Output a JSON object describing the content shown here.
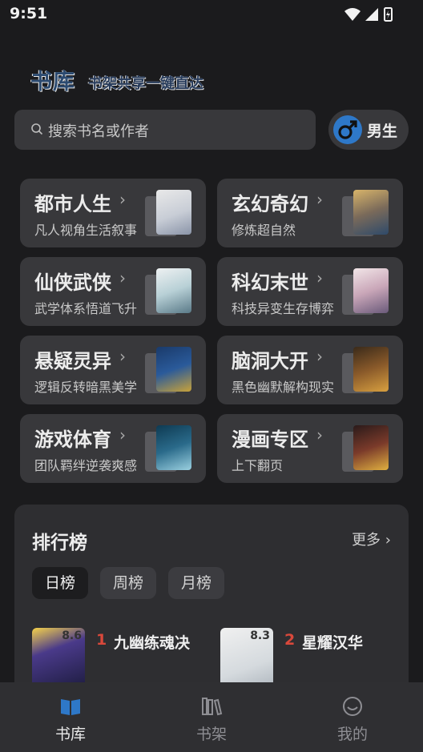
{
  "status_bar": {
    "time": "9:51"
  },
  "header": {
    "title": "书库",
    "slogan": "书架共享一键直达"
  },
  "search": {
    "placeholder": "搜索书名或作者"
  },
  "gender_toggle": {
    "label": "男生"
  },
  "categories": [
    {
      "name": "都市人生",
      "desc": "凡人视角生活叙事"
    },
    {
      "name": "玄幻奇幻",
      "desc": "修炼超自然"
    },
    {
      "name": "仙侠武侠",
      "desc": "武学体系悟道飞升"
    },
    {
      "name": "科幻末世",
      "desc": "科技异变生存博弈"
    },
    {
      "name": "悬疑灵异",
      "desc": "逻辑反转暗黑美学"
    },
    {
      "name": "脑洞大开",
      "desc": "黑色幽默解构现实"
    },
    {
      "name": "游戏体育",
      "desc": "团队羁绊逆袭爽感"
    },
    {
      "name": "漫画专区",
      "desc": "上下翻页"
    }
  ],
  "ranking": {
    "title": "排行榜",
    "more": "更多",
    "tabs": [
      "日榜",
      "周榜",
      "月榜"
    ],
    "books": [
      {
        "rank": "1",
        "title": "九幽练魂决",
        "score": "8.6"
      },
      {
        "rank": "2",
        "title": "星耀汉华",
        "score": "8.3"
      }
    ]
  },
  "bottom_nav": [
    {
      "label": "书库",
      "icon": "book-open-icon",
      "active": true
    },
    {
      "label": "书架",
      "icon": "bookshelf-icon",
      "active": false
    },
    {
      "label": "我的",
      "icon": "smile-icon",
      "active": false
    }
  ],
  "colors": {
    "background": "#1b1b1d",
    "card": "#38383b",
    "accent": "#2e78c8",
    "rank_red": "#d9483b"
  }
}
